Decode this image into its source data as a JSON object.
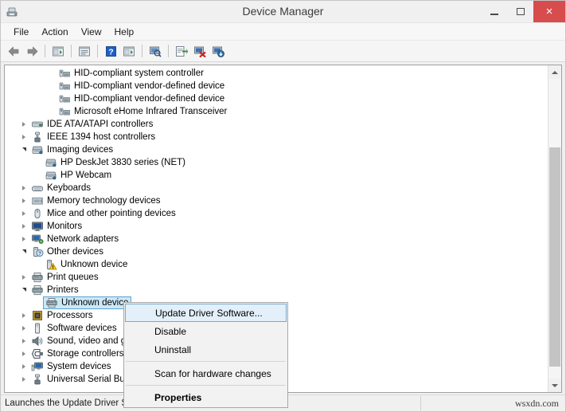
{
  "window": {
    "title": "Device Manager",
    "app_icon": "device-manager-icon",
    "controls": {
      "minimize": "minimize-button",
      "maximize": "maximize-button",
      "close": "close-button",
      "close_glyph": "×",
      "close_color": "#d74c4c"
    }
  },
  "menubar": {
    "items": [
      {
        "label": "File"
      },
      {
        "label": "Action"
      },
      {
        "label": "View"
      },
      {
        "label": "Help"
      }
    ]
  },
  "toolbar": {
    "buttons": [
      {
        "name": "back-button",
        "icon": "left-arrow-icon"
      },
      {
        "name": "forward-button",
        "icon": "right-arrow-icon"
      },
      {
        "name": "separator-1",
        "icon": "separator"
      },
      {
        "name": "show-hide-console-tree-button",
        "icon": "console-tree-icon"
      },
      {
        "name": "separator-2",
        "icon": "separator"
      },
      {
        "name": "properties-button",
        "icon": "properties-window-icon"
      },
      {
        "name": "separator-3",
        "icon": "separator"
      },
      {
        "name": "help-button",
        "icon": "help-question-icon"
      },
      {
        "name": "show-hide-action-pane-button",
        "icon": "action-pane-icon"
      },
      {
        "name": "separator-4",
        "icon": "separator"
      },
      {
        "name": "scan-for-hardware-changes-button",
        "icon": "scan-hardware-icon"
      },
      {
        "name": "separator-5",
        "icon": "separator"
      },
      {
        "name": "update-driver-software-button",
        "icon": "update-driver-icon"
      },
      {
        "name": "uninstall-button",
        "icon": "uninstall-device-icon"
      },
      {
        "name": "disable-button",
        "icon": "disable-device-icon"
      }
    ]
  },
  "tree": {
    "rows": [
      {
        "label": "HID-compliant system controller",
        "indent": 3,
        "twisty": "none",
        "icon": "hid-device-icon",
        "selected": false
      },
      {
        "label": "HID-compliant vendor-defined device",
        "indent": 3,
        "twisty": "none",
        "icon": "hid-device-icon",
        "selected": false
      },
      {
        "label": "HID-compliant vendor-defined device",
        "indent": 3,
        "twisty": "none",
        "icon": "hid-device-icon",
        "selected": false
      },
      {
        "label": "Microsoft eHome Infrared Transceiver",
        "indent": 3,
        "twisty": "none",
        "icon": "hid-device-icon",
        "selected": false
      },
      {
        "label": "IDE ATA/ATAPI controllers",
        "indent": 1,
        "twisty": "collapsed",
        "icon": "ide-controller-icon",
        "selected": false
      },
      {
        "label": "IEEE 1394 host controllers",
        "indent": 1,
        "twisty": "collapsed",
        "icon": "usb-port-icon",
        "selected": false
      },
      {
        "label": "Imaging devices",
        "indent": 1,
        "twisty": "expanded",
        "icon": "imaging-device-icon",
        "selected": false
      },
      {
        "label": "HP DeskJet 3830 series (NET)",
        "indent": 2,
        "twisty": "none",
        "icon": "imaging-device-icon",
        "selected": false
      },
      {
        "label": "HP Webcam",
        "indent": 2,
        "twisty": "none",
        "icon": "imaging-device-icon",
        "selected": false
      },
      {
        "label": "Keyboards",
        "indent": 1,
        "twisty": "collapsed",
        "icon": "keyboard-icon",
        "selected": false
      },
      {
        "label": "Memory technology devices",
        "indent": 1,
        "twisty": "collapsed",
        "icon": "memory-device-icon",
        "selected": false
      },
      {
        "label": "Mice and other pointing devices",
        "indent": 1,
        "twisty": "collapsed",
        "icon": "mouse-icon",
        "selected": false
      },
      {
        "label": "Monitors",
        "indent": 1,
        "twisty": "collapsed",
        "icon": "monitor-icon",
        "selected": false
      },
      {
        "label": "Network adapters",
        "indent": 1,
        "twisty": "collapsed",
        "icon": "network-adapter-icon",
        "selected": false
      },
      {
        "label": "Other devices",
        "indent": 1,
        "twisty": "expanded",
        "icon": "other-device-icon",
        "selected": false
      },
      {
        "label": "Unknown device",
        "indent": 2,
        "twisty": "none",
        "icon": "unknown-device-warning-icon",
        "selected": false
      },
      {
        "label": "Print queues",
        "indent": 1,
        "twisty": "collapsed",
        "icon": "printer-icon",
        "selected": false
      },
      {
        "label": "Printers",
        "indent": 1,
        "twisty": "expanded",
        "icon": "printer-icon",
        "selected": false
      },
      {
        "label": "Unknown device",
        "indent": 2,
        "twisty": "none",
        "icon": "printer-icon",
        "selected": true
      },
      {
        "label": "Processors",
        "indent": 1,
        "twisty": "collapsed",
        "icon": "processor-icon",
        "selected": false
      },
      {
        "label": "Software devices",
        "indent": 1,
        "twisty": "collapsed",
        "icon": "software-device-icon",
        "selected": false
      },
      {
        "label": "Sound, video and game controllers",
        "indent": 1,
        "twisty": "collapsed",
        "icon": "sound-device-icon",
        "selected": false
      },
      {
        "label": "Storage controllers",
        "indent": 1,
        "twisty": "collapsed",
        "icon": "storage-controller-icon",
        "selected": false
      },
      {
        "label": "System devices",
        "indent": 1,
        "twisty": "collapsed",
        "icon": "system-device-icon",
        "selected": false
      },
      {
        "label": "Universal Serial Bus controllers",
        "indent": 1,
        "twisty": "collapsed",
        "icon": "usb-controller-icon",
        "selected": false
      }
    ],
    "selection_colors": {
      "fill": "#cce8f7",
      "border": "#5ba3d0"
    }
  },
  "context_menu": {
    "items": [
      {
        "label": "Update Driver Software...",
        "highlight": true,
        "bold": false
      },
      {
        "label": "Disable",
        "highlight": false,
        "bold": false
      },
      {
        "label": "Uninstall",
        "highlight": false,
        "bold": false
      },
      {
        "label": "__separator__",
        "highlight": false,
        "bold": false
      },
      {
        "label": "Scan for hardware changes",
        "highlight": false,
        "bold": false
      },
      {
        "label": "__separator__",
        "highlight": false,
        "bold": false
      },
      {
        "label": "Properties",
        "highlight": false,
        "bold": true
      }
    ],
    "highlight_fill": "#e3f0f9",
    "highlight_border": "#7aa9cc"
  },
  "statusbar": {
    "text": "Launches the Update Driver Software Wizard for the selected device.",
    "watermark": "wsxdn.com"
  },
  "scrollbar": {
    "up_arrow": "scroll-up-arrow",
    "down_arrow": "scroll-down-arrow",
    "thumb": "scroll-thumb"
  }
}
